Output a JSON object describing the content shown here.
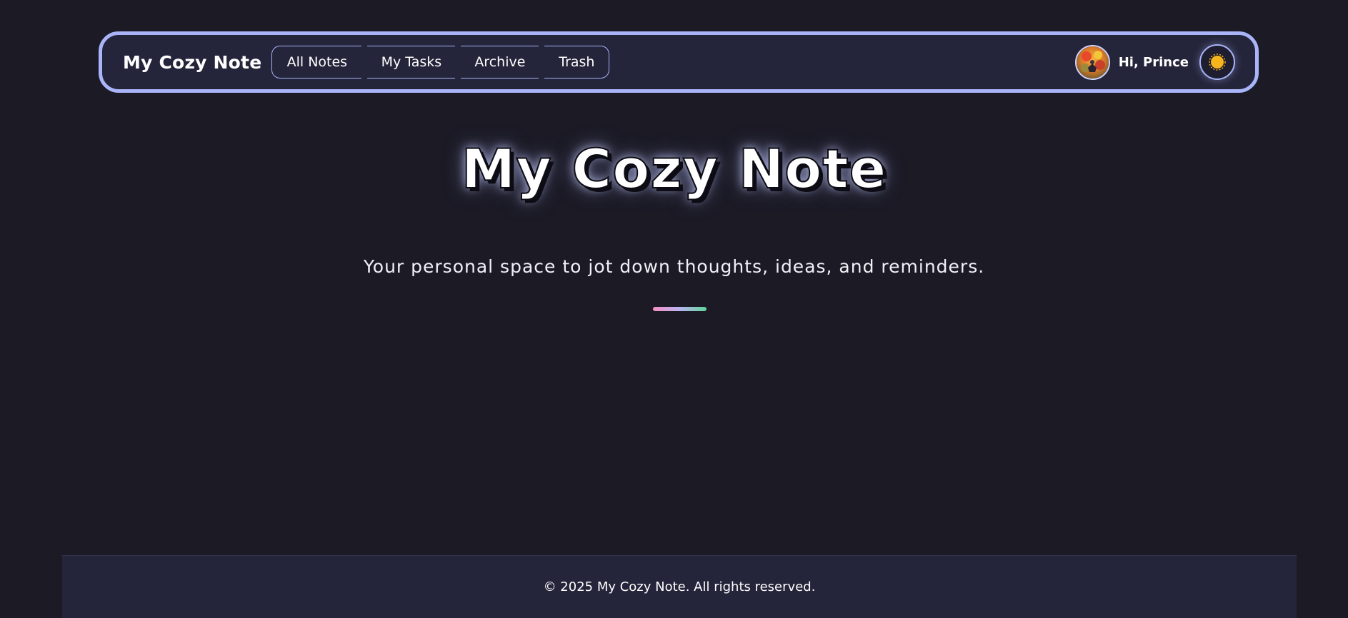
{
  "navbar": {
    "brand": "My Cozy Note",
    "links": [
      {
        "label": "All Notes"
      },
      {
        "label": "My Tasks"
      },
      {
        "label": "Archive"
      },
      {
        "label": "Trash"
      }
    ],
    "user": {
      "greeting": "Hi, Prince",
      "avatar_icon": "user-avatar-photo"
    },
    "theme_toggle": {
      "icon": "sun-icon"
    }
  },
  "hero": {
    "title": "My Cozy Note",
    "subtitle": "Your personal space to jot down thoughts, ideas, and reminders."
  },
  "footer": {
    "text": "© 2025 My Cozy Note. All rights reserved."
  },
  "colors": {
    "background": "#1b1a25",
    "navbar_background": "#24243a",
    "accent_border": "#a9b4f9",
    "sun": "#f7b51d",
    "divider_gradient": [
      "#f48fc4",
      "#b9b4f0",
      "#5fd49a"
    ]
  }
}
